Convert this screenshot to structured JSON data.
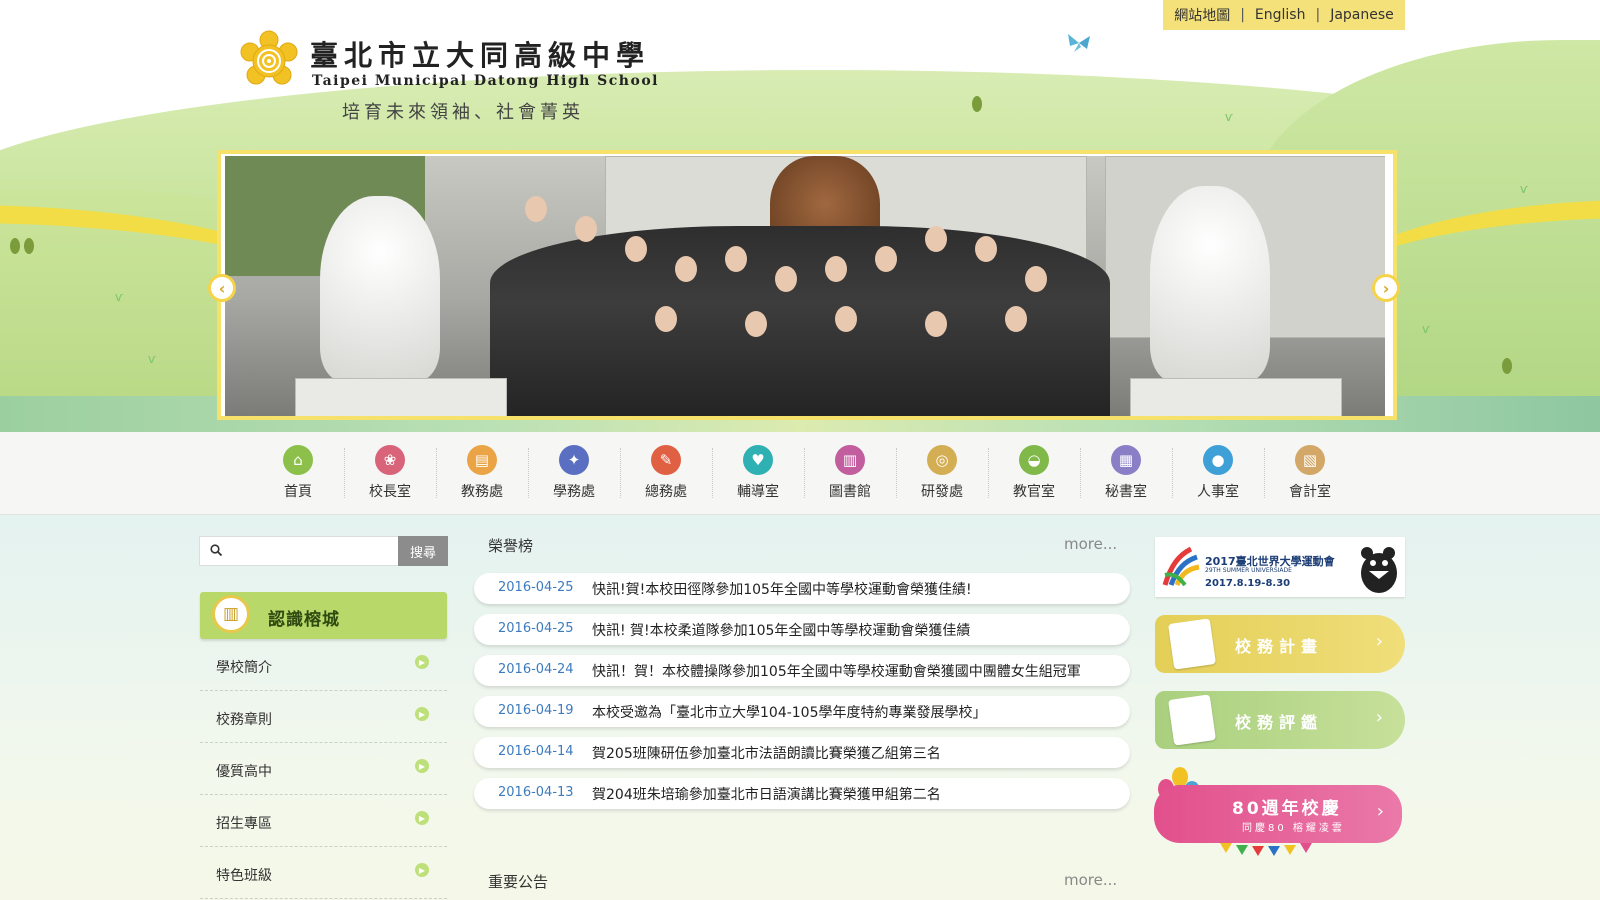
{
  "header": {
    "school_name_zh": "臺北市立大同高級中學",
    "school_name_en": "Taipei Municipal Datong High School",
    "slogan": "培育未來領袖、社會菁英",
    "top_links": [
      "網站地圖",
      "English",
      "Japanese"
    ]
  },
  "nav": [
    {
      "label": "首頁",
      "icon": "home-icon",
      "color": "#8cc04a",
      "glyph": "⌂"
    },
    {
      "label": "校長室",
      "icon": "flower-icon",
      "color": "#d9647a",
      "glyph": "❀"
    },
    {
      "label": "教務處",
      "icon": "book-icon",
      "color": "#eba445",
      "glyph": "▤"
    },
    {
      "label": "學務處",
      "icon": "runner-icon",
      "color": "#5a6fc1",
      "glyph": "✦"
    },
    {
      "label": "總務處",
      "icon": "wrench-icon",
      "color": "#e06044",
      "glyph": "✎"
    },
    {
      "label": "輔導室",
      "icon": "heart-icon",
      "color": "#2fb0b2",
      "glyph": "♥"
    },
    {
      "label": "圖書館",
      "icon": "library-icon",
      "color": "#c25d9e",
      "glyph": "▥"
    },
    {
      "label": "研發處",
      "icon": "lightbulb-icon",
      "color": "#d4ae53",
      "glyph": "◎"
    },
    {
      "label": "教官室",
      "icon": "cap-icon",
      "color": "#80b94a",
      "glyph": "◒"
    },
    {
      "label": "秘書室",
      "icon": "clipboard-icon",
      "color": "#8a7fc7",
      "glyph": "▦"
    },
    {
      "label": "人事室",
      "icon": "person-icon",
      "color": "#3fa0d8",
      "glyph": "●"
    },
    {
      "label": "會計室",
      "icon": "ledger-icon",
      "color": "#d2a767",
      "glyph": "▧"
    }
  ],
  "search": {
    "placeholder": "",
    "button": "搜尋"
  },
  "sidebar": {
    "title": "認識榕城",
    "items": [
      "學校簡介",
      "校務章則",
      "優質高中",
      "招生專區",
      "特色班級"
    ]
  },
  "news": {
    "title": "榮譽榜",
    "more": "more...",
    "items": [
      {
        "date": "2016-04-25",
        "text": "快訊!賀!本校田徑隊參加105年全國中等學校運動會榮獲佳績!"
      },
      {
        "date": "2016-04-25",
        "text": "快訊! 賀!本校柔道隊參加105年全國中等學校運動會榮獲佳績"
      },
      {
        "date": "2016-04-24",
        "text": "快訊！賀！本校體操隊參加105年全國中等學校運動會榮獲國中團體女生組冠軍"
      },
      {
        "date": "2016-04-19",
        "text": "本校受邀為「臺北市立大學104-105學年度特約專業發展學校」"
      },
      {
        "date": "2016-04-14",
        "text": "賀205班陳研伍參加臺北市法語朗讀比賽榮獲乙組第三名"
      },
      {
        "date": "2016-04-13",
        "text": "賀204班朱培瑜參加臺北市日語演講比賽榮獲甲組第二名"
      }
    ]
  },
  "news2": {
    "title": "重要公告",
    "more": "more..."
  },
  "banners": {
    "universiade": {
      "title": "2017臺北世界大學運動會",
      "sub": "29TH SUMMER UNIVERSIADE",
      "date": "2017.8.19-8.30"
    },
    "plan": {
      "label": "校務計畫",
      "color": "#e3cf57"
    },
    "review": {
      "label": "校務評鑑",
      "color": "#a9d07e"
    },
    "anniversary": {
      "title": "80週年校慶",
      "sub": "同慶80 榕耀凌雲",
      "color": "#e2508c"
    }
  }
}
